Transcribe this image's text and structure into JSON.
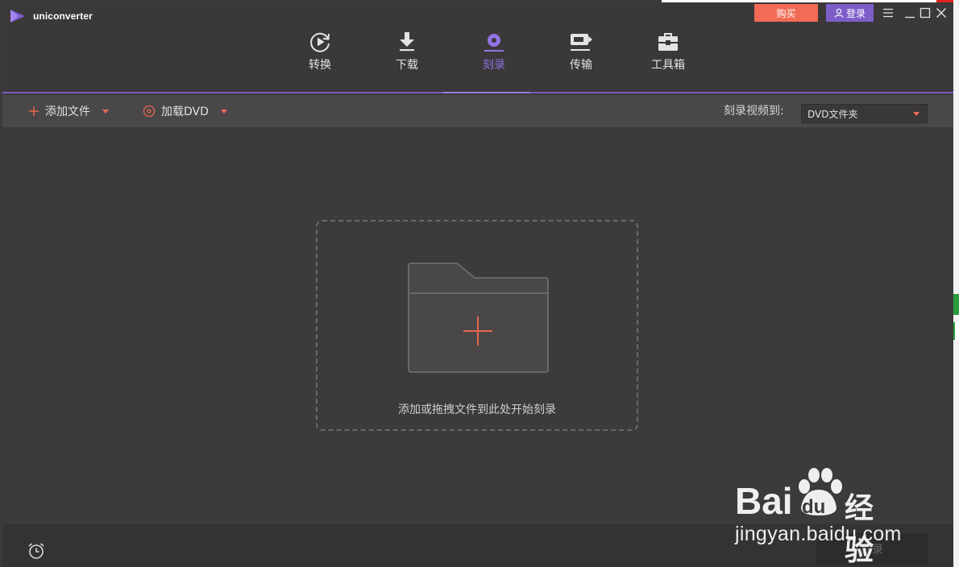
{
  "app": {
    "title": "uniconverter"
  },
  "header": {
    "buy_label": "购买",
    "login_label": "登录",
    "tabs": [
      {
        "label": "转换",
        "icon": "convert-icon"
      },
      {
        "label": "下载",
        "icon": "download-icon"
      },
      {
        "label": "刻录",
        "icon": "burn-icon",
        "active": true
      },
      {
        "label": "传输",
        "icon": "transfer-icon"
      },
      {
        "label": "工具箱",
        "icon": "toolbox-icon"
      }
    ]
  },
  "toolbar": {
    "add_file_label": "添加文件",
    "load_dvd_label": "加载DVD",
    "burn_to_label": "刻录视频到:",
    "burn_to_value": "DVD文件夹"
  },
  "dropzone": {
    "hint": "添加或拖拽文件到此处开始刻录"
  },
  "footer": {
    "burn_button_label": "刻录"
  },
  "watermark": {
    "brand": "Bai",
    "brand_paw": "du",
    "brand_cn": "经验",
    "url": "jingyan.baidu.com"
  },
  "colors": {
    "accent": "#8f6fe0",
    "buy": "#f26b55",
    "login": "#7d5ec9",
    "plus": "#e8664f"
  }
}
